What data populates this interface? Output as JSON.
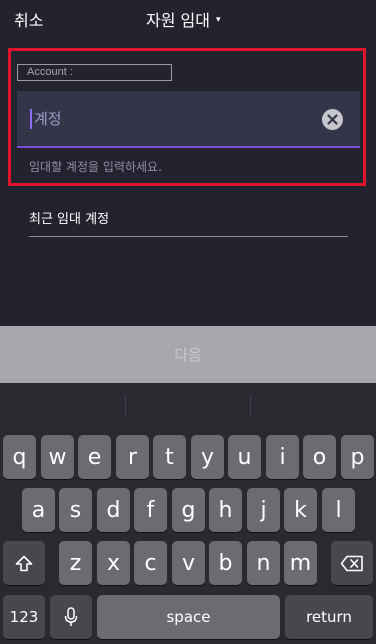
{
  "header": {
    "cancel_label": "취소",
    "title": "자원 임대",
    "title_caret": "▾"
  },
  "form": {
    "account_tag": "Account :",
    "input_value": "계정",
    "helper_text": "임대할 계정을 입력하세요.",
    "recent_label": "최근 임대 계정"
  },
  "next_button": {
    "label": "다음"
  },
  "keyboard": {
    "row1": [
      "q",
      "w",
      "e",
      "r",
      "t",
      "y",
      "u",
      "i",
      "o",
      "p"
    ],
    "row2": [
      "a",
      "s",
      "d",
      "f",
      "g",
      "h",
      "j",
      "k",
      "l"
    ],
    "row3": [
      "z",
      "x",
      "c",
      "v",
      "b",
      "n",
      "m"
    ],
    "numbers_label": "123",
    "space_label": "space",
    "return_label": "return"
  },
  "colors": {
    "highlight": "#e1142b",
    "accent": "#7c4dd8",
    "background": "#23232f"
  }
}
